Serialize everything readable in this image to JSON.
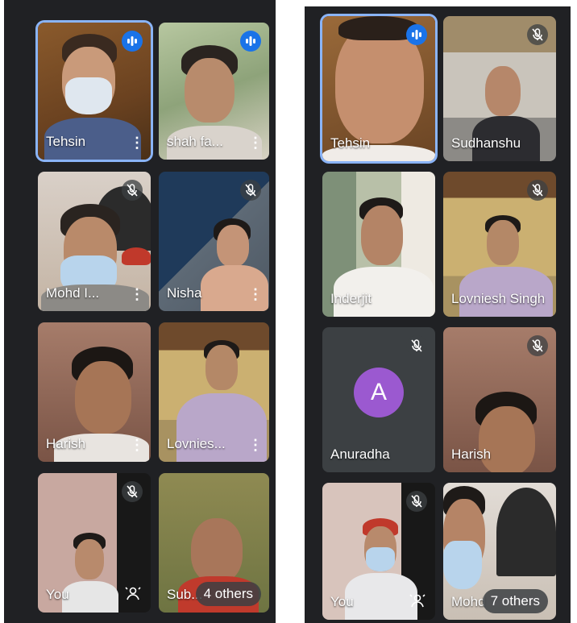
{
  "left_panel": {
    "tiles": [
      {
        "name": "Tehsin"
      },
      {
        "name": "shah fa..."
      },
      {
        "name": "Mohd I..."
      },
      {
        "name": "Nisha"
      },
      {
        "name": "Harish"
      },
      {
        "name": "Lovnies..."
      },
      {
        "name": "You"
      },
      {
        "name": "Sub..."
      }
    ],
    "others_label": "4 others"
  },
  "right_panel": {
    "tiles": [
      {
        "name": "Tehsin"
      },
      {
        "name": "Sudhanshu"
      },
      {
        "name": "Inderjit"
      },
      {
        "name": "Lovniesh Singh"
      },
      {
        "name": "Anuradha",
        "avatar_letter": "A"
      },
      {
        "name": "Harish"
      },
      {
        "name": "You"
      },
      {
        "name": "Mohd"
      }
    ],
    "others_label": "7 others"
  },
  "colors": {
    "background": "#202124",
    "speaking_border": "#8ab4f8",
    "active_badge": "#1a73e8",
    "avatar": "#9b59d0"
  },
  "icons": [
    "audio-level-icon",
    "mic-off-icon",
    "more-vert-icon",
    "captions-icon"
  ]
}
